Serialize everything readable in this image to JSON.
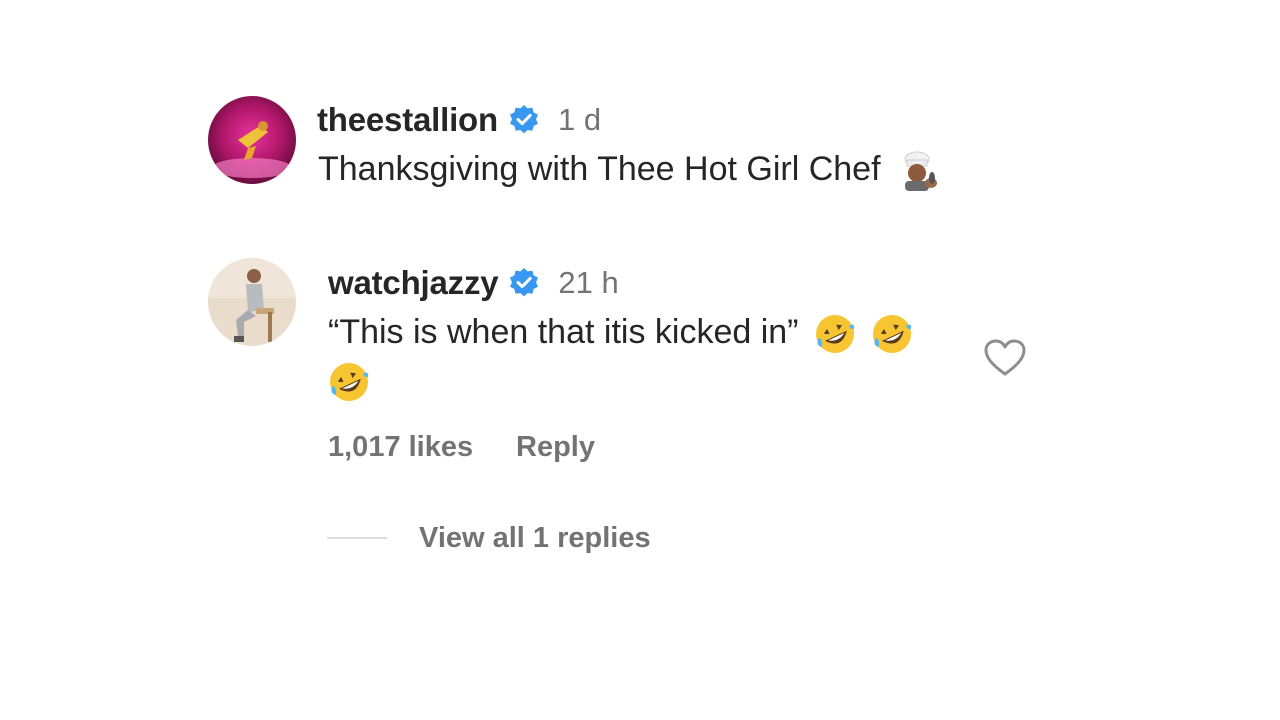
{
  "comment": {
    "username": "theestallion",
    "time": "1 d",
    "text": "Thanksgiving with Thee Hot Girl Chef",
    "emoji": "cook-emoji"
  },
  "reply": {
    "username": "watchjazzy",
    "time": "21 h",
    "text": "“This is when that itis kicked in”",
    "emoji": "rolling-on-floor-laughing-emoji",
    "likes": "1,017 likes",
    "reply_label": "Reply",
    "view_replies": "View all 1 replies"
  },
  "colors": {
    "verified": "#3897f0",
    "secondary_text": "#737373",
    "primary_text": "#262626"
  }
}
